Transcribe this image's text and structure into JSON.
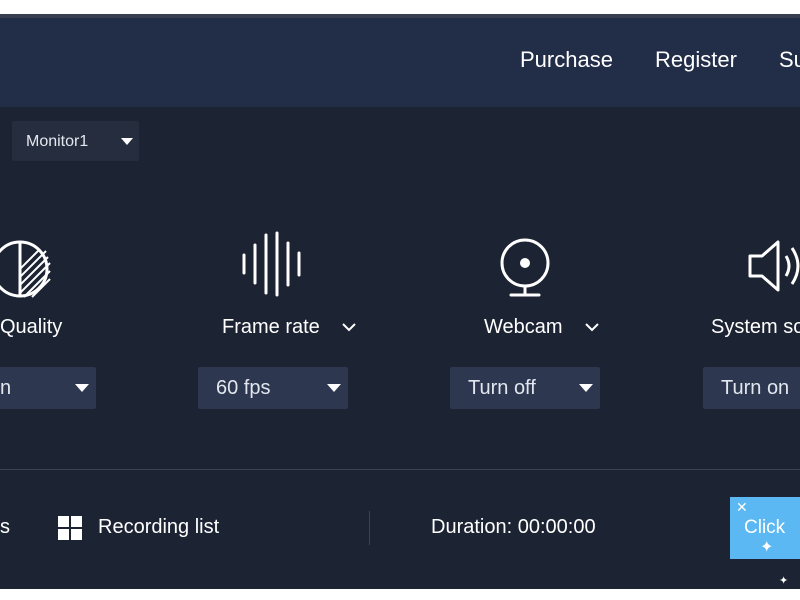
{
  "header": {
    "links": [
      "Purchase",
      "Register",
      "Su"
    ]
  },
  "monitor_select": {
    "value": "Monitor1"
  },
  "features": [
    {
      "title": "Quality",
      "icon": "quality-icon",
      "value": "n"
    },
    {
      "title": "Frame rate",
      "icon": "waveform-icon",
      "value": "60 fps"
    },
    {
      "title": "Webcam",
      "icon": "webcam-icon",
      "value": "Turn off"
    },
    {
      "title": "System so",
      "icon": "speaker-icon",
      "value": "Turn on"
    }
  ],
  "footer": {
    "left_partial": "s",
    "recording_list_label": "Recording list",
    "duration_label": "Duration: 00:00:00",
    "cta_label": "Click"
  },
  "colors": {
    "window_bg": "#1c2333",
    "header_bg": "#222d48",
    "dropdown_bg": "#2d3850",
    "cta_bg": "#5bb8f2"
  }
}
